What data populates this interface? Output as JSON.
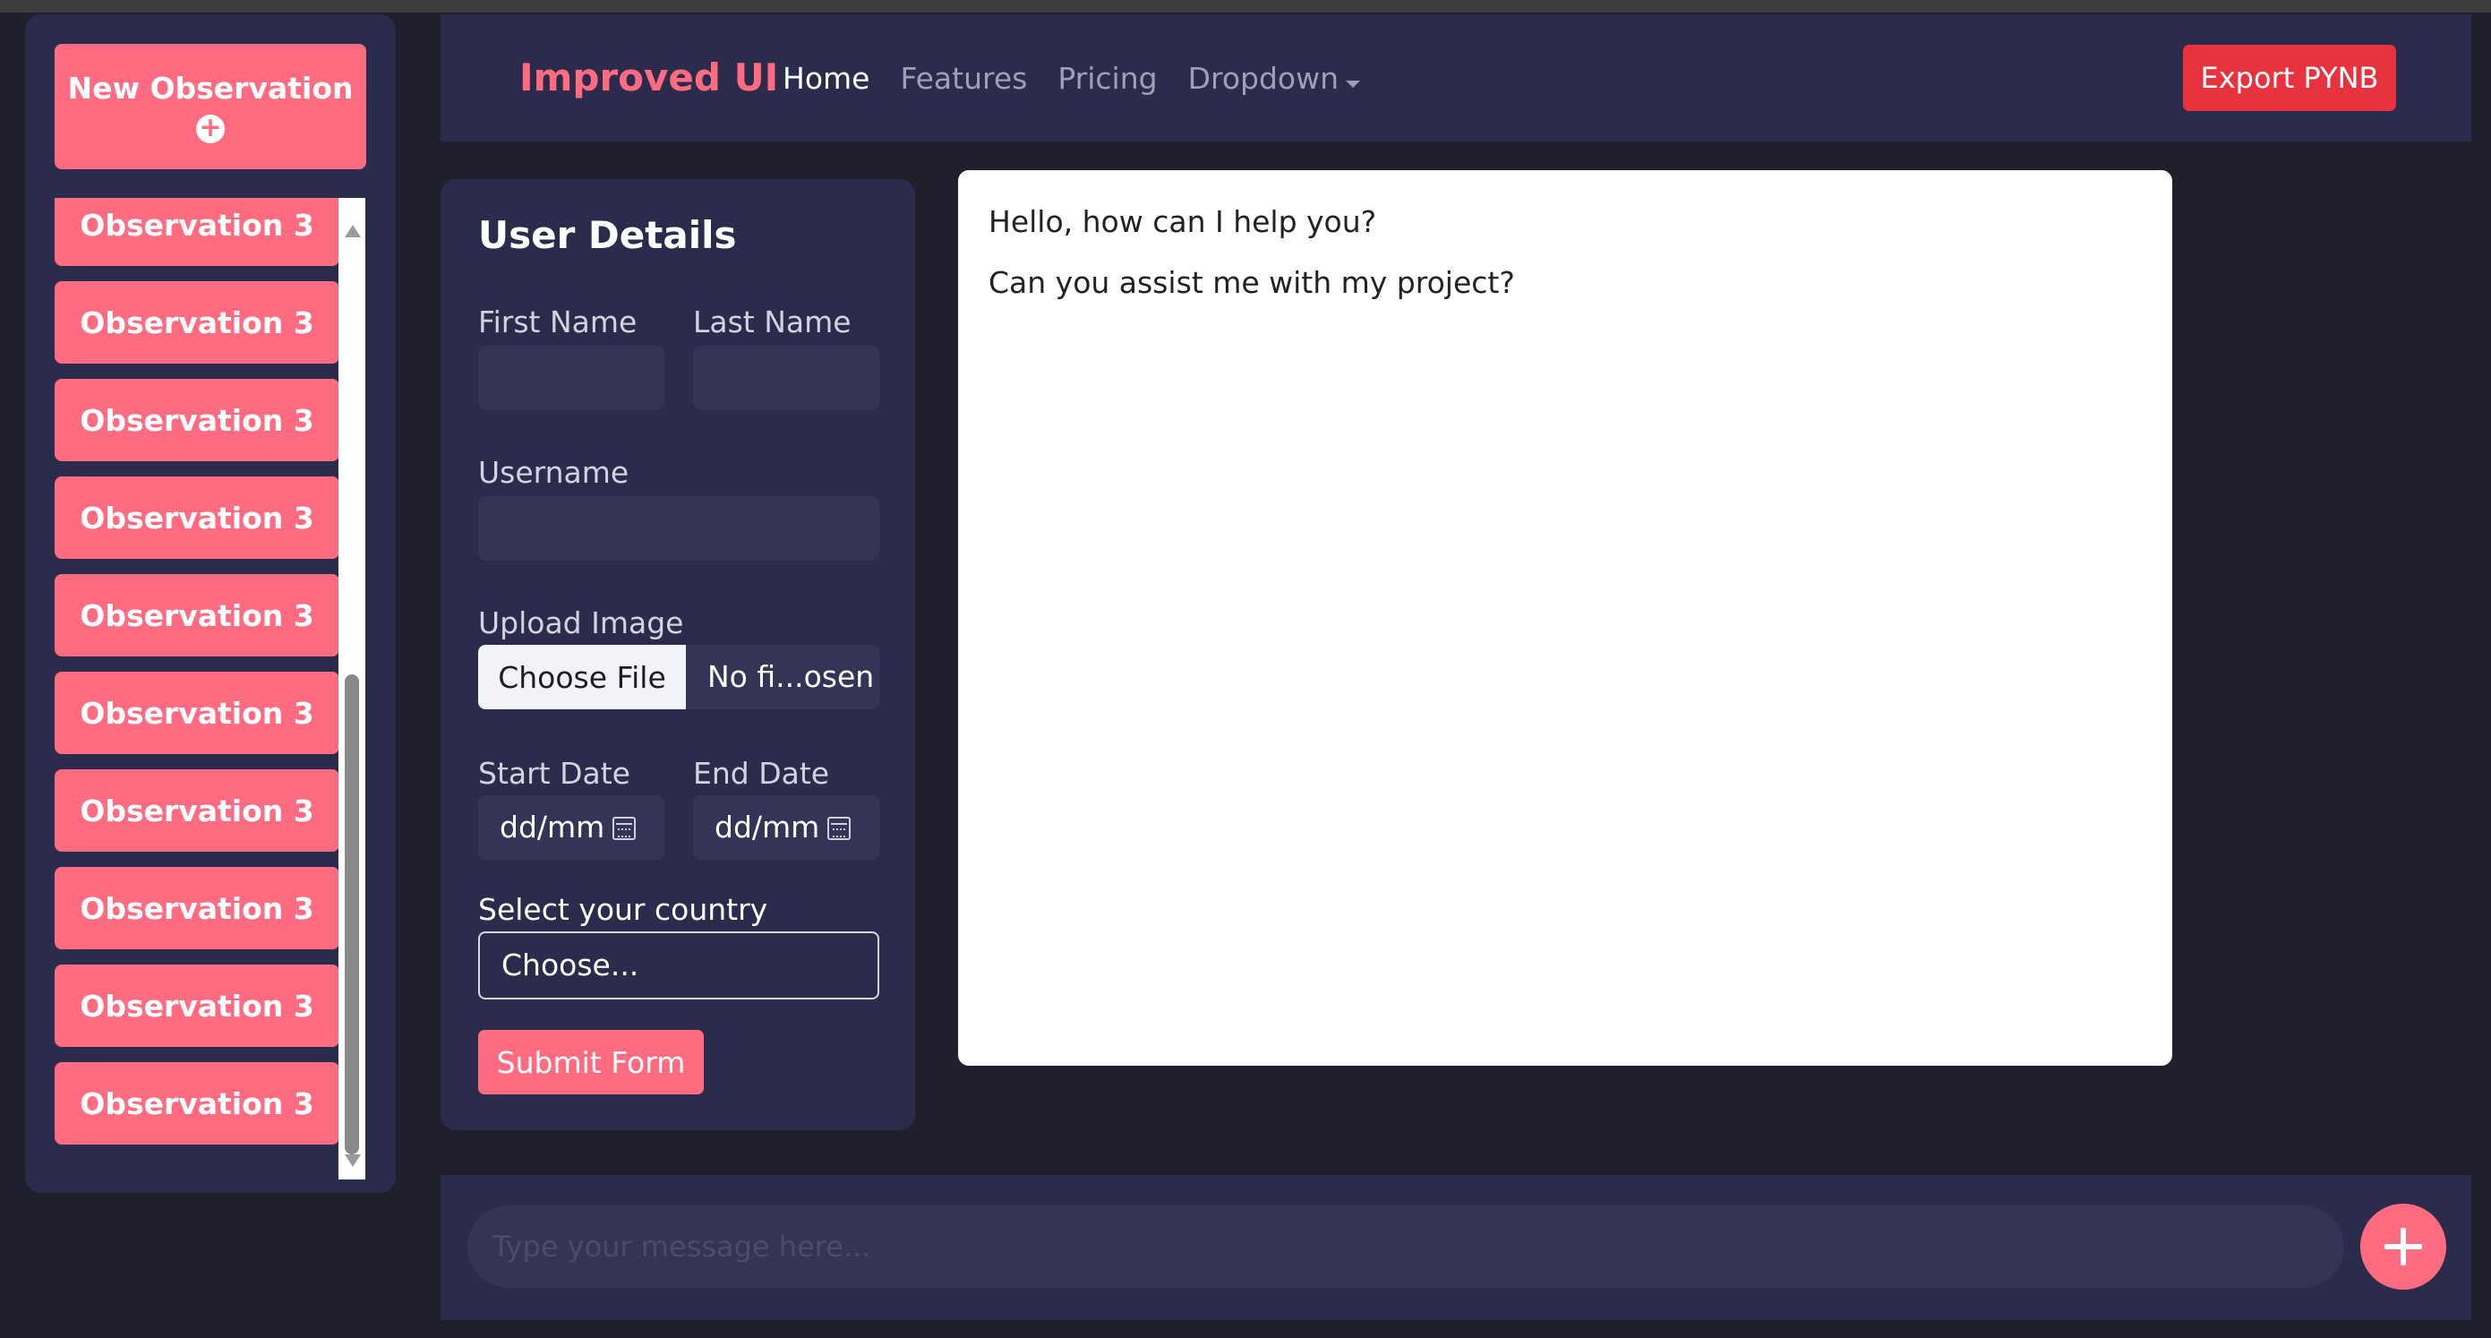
{
  "sidebar": {
    "new_observation_label": "New Observation",
    "new_observation_icon": "plus-circle-icon",
    "observations": [
      "Observation 3",
      "Observation 3",
      "Observation 3",
      "Observation 3",
      "Observation 3",
      "Observation 3",
      "Observation 3",
      "Observation 3",
      "Observation 3",
      "Observation 3"
    ]
  },
  "navbar": {
    "brand": "Improved UI",
    "links": [
      "Home",
      "Features",
      "Pricing",
      "Dropdown"
    ],
    "active_link": "Home",
    "export_label": "Export PYNB"
  },
  "form": {
    "title": "User Details",
    "first_name_label": "First Name",
    "last_name_label": "Last Name",
    "username_label": "Username",
    "upload_label": "Upload Image",
    "choose_file_label": "Choose File",
    "file_status": "No fi...osen",
    "start_date_label": "Start Date",
    "end_date_label": "End Date",
    "start_date_value": "dd/mm",
    "end_date_value": "dd/mm",
    "country_label": "Select your country",
    "country_value": "Choose...",
    "submit_label": "Submit Form"
  },
  "chat": {
    "messages": [
      "Hello, how can I help you?",
      "Can you assist me with my project?"
    ]
  },
  "composer": {
    "placeholder": "Type your message here..."
  },
  "colors": {
    "accent": "#ff6b81",
    "export": "#e8333f",
    "panel": "#2b2c4b",
    "background": "#1f1f2e"
  }
}
